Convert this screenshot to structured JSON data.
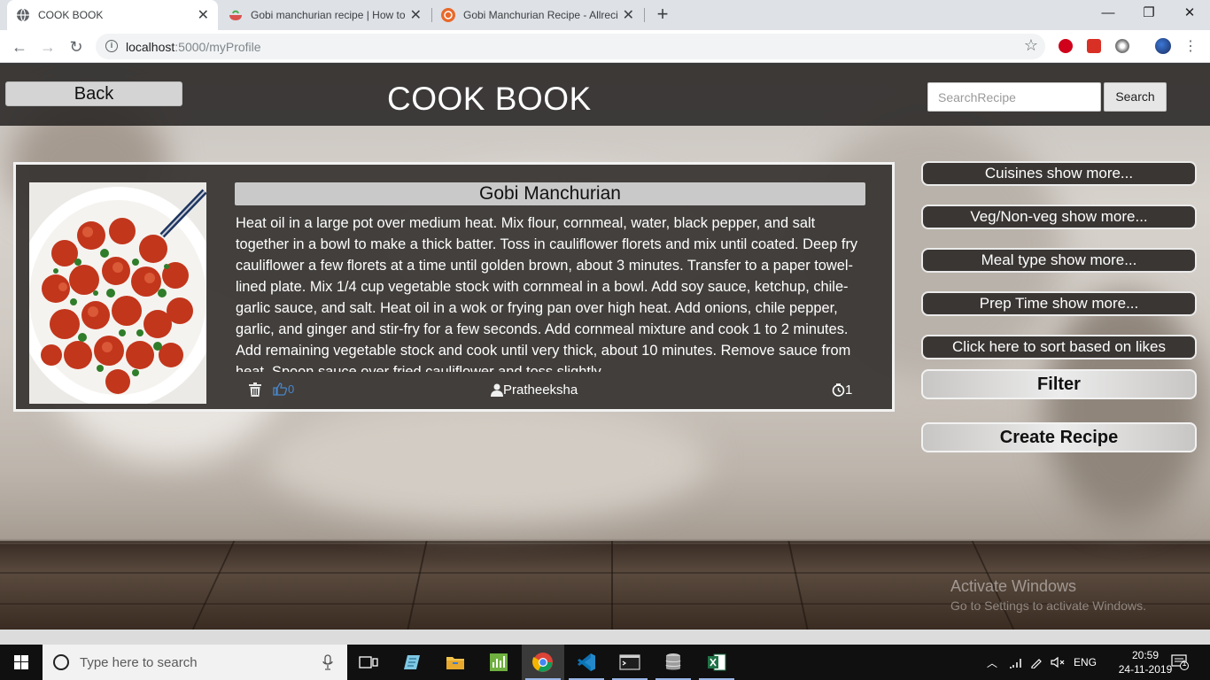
{
  "browser": {
    "tabs": [
      {
        "title": "COOK BOOK",
        "active": true
      },
      {
        "title": "Gobi manchurian recipe | How to",
        "active": false
      },
      {
        "title": "Gobi Manchurian Recipe - Allreci",
        "active": false
      }
    ],
    "url_host": "localhost",
    "url_rest": ":5000/myProfile"
  },
  "header": {
    "back_label": "Back",
    "app_title": "COOK BOOK",
    "search_placeholder": "SearchRecipe",
    "search_label": "Search"
  },
  "recipe": {
    "title": "Gobi Manchurian",
    "description": "Heat oil in a large pot over medium heat. Mix flour, cornmeal, water, black pepper, and salt together in a bowl to make a thick batter. Toss in cauliflower florets and mix until coated. Deep fry cauliflower a few florets at a time until golden brown, about 3 minutes. Transfer to a paper towel-lined plate. Mix 1/4 cup vegetable stock with cornmeal in a bowl. Add soy sauce, ketchup, chile-garlic sauce, and salt. Heat oil in a wok or frying pan over high heat. Add onions, chile pepper, garlic, and ginger and stir-fry for a few seconds. Add cornmeal mixture and cook 1 to 2 minutes. Add remaining vegetable stock and cook until very thick, about 10 minutes. Remove sauce from heat. Spoon sauce over fried cauliflower and toss slightly.",
    "likes": "0",
    "author": "Pratheeksha",
    "prep_time": "1"
  },
  "sidebar": {
    "cuisines": "Cuisines show more...",
    "veg": "Veg/Non-veg show more...",
    "meal_type": "Meal type show more...",
    "prep_time": "Prep Time show more...",
    "sort_likes": "Click here to sort based on likes",
    "filter": "Filter",
    "create": "Create Recipe"
  },
  "watermark": {
    "line1": "Activate Windows",
    "line2": "Go to Settings to activate Windows."
  },
  "taskbar": {
    "search_placeholder": "Type here to search",
    "language": "ENG",
    "time": "20:59",
    "date": "24-11-2019",
    "notifications": "1"
  },
  "colors": {
    "header_bg": "#282624",
    "card_bg": "#373432",
    "like_blue": "#4a86c9"
  }
}
